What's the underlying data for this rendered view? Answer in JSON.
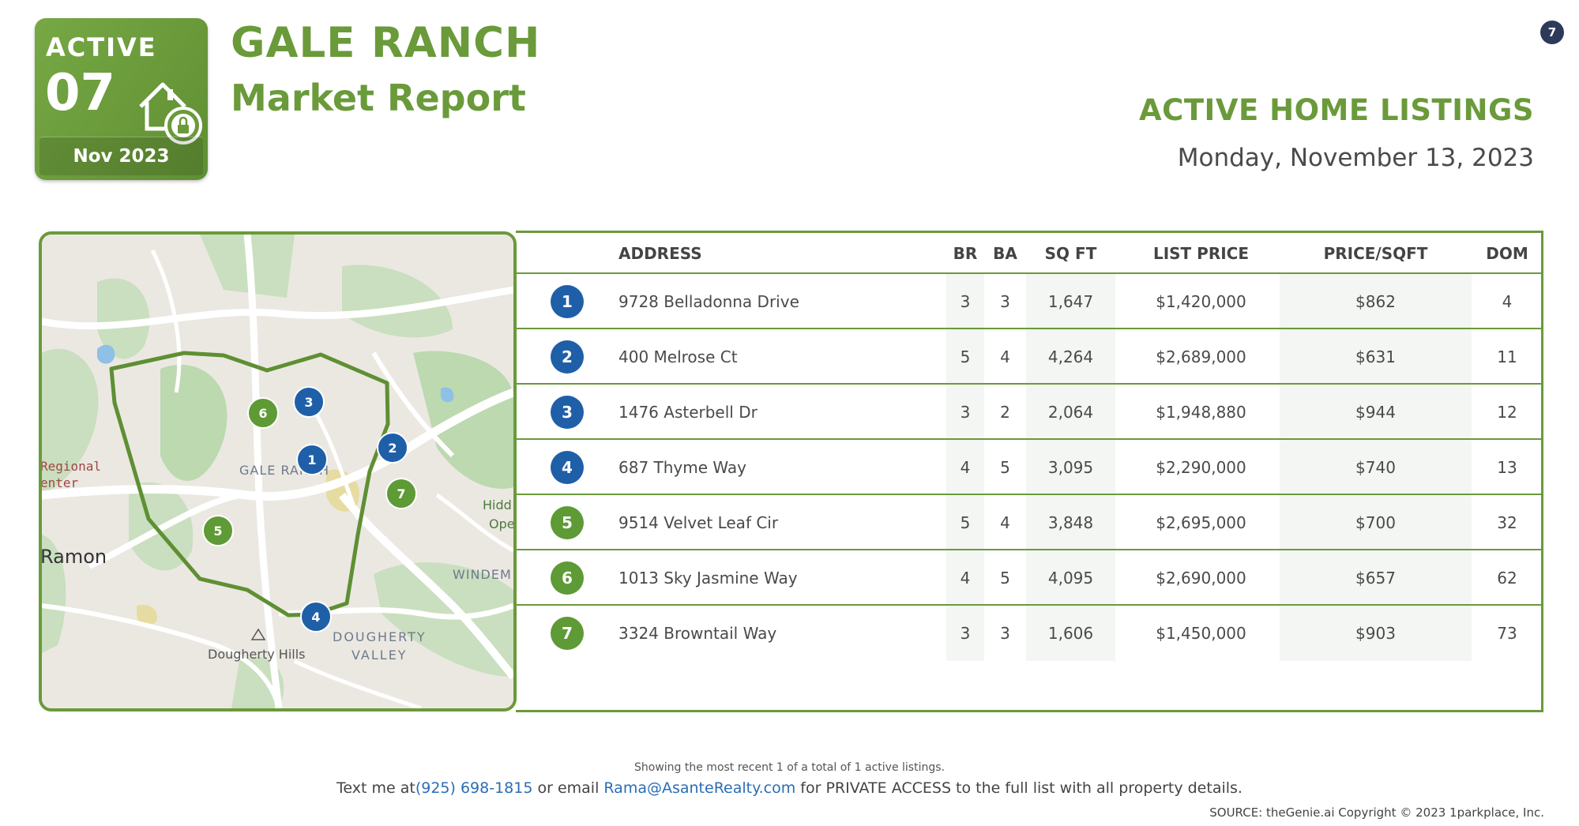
{
  "badge": {
    "status": "ACTIVE",
    "count": "07",
    "month": "Nov 2023",
    "icon": "house-lock-icon"
  },
  "header": {
    "title": "GALE RANCH",
    "subtitle": "Market Report",
    "page_number": "7"
  },
  "section": {
    "title": "ACTIVE HOME LISTINGS",
    "date": "Monday, November 13, 2023"
  },
  "map": {
    "labels": {
      "gale_ranch": "GALE RANCH",
      "regional": "Regional",
      "center": "enter",
      "ramon": "Ramon",
      "hidden": "Hidd",
      "open": "Ope",
      "windem": "WINDEM",
      "dougherty_hills": "Dougherty Hills",
      "dougherty": "DOUGHERTY",
      "valley": "VALLEY"
    },
    "markers": [
      "1",
      "2",
      "3",
      "4",
      "5",
      "6",
      "7"
    ]
  },
  "table": {
    "headers": {
      "address": "ADDRESS",
      "br": "BR",
      "ba": "BA",
      "sqft": "SQ FT",
      "list_price": "LIST PRICE",
      "price_sqft": "PRICE/SQFT",
      "dom": "DOM"
    },
    "rows": [
      {
        "num": "1",
        "address": "9728 Belladonna Drive",
        "br": "3",
        "ba": "3",
        "sqft": "1,647",
        "price": "$1,420,000",
        "ppsf": "$862",
        "dom": "4",
        "color": "#1f5fa8"
      },
      {
        "num": "2",
        "address": "400 Melrose Ct",
        "br": "5",
        "ba": "4",
        "sqft": "4,264",
        "price": "$2,689,000",
        "ppsf": "$631",
        "dom": "11",
        "color": "#1f5fa8"
      },
      {
        "num": "3",
        "address": "1476 Asterbell Dr",
        "br": "3",
        "ba": "2",
        "sqft": "2,064",
        "price": "$1,948,880",
        "ppsf": "$944",
        "dom": "12",
        "color": "#1f5fa8"
      },
      {
        "num": "4",
        "address": "687 Thyme Way",
        "br": "4",
        "ba": "5",
        "sqft": "3,095",
        "price": "$2,290,000",
        "ppsf": "$740",
        "dom": "13",
        "color": "#1f5fa8"
      },
      {
        "num": "5",
        "address": "9514 Velvet Leaf Cir",
        "br": "5",
        "ba": "4",
        "sqft": "3,848",
        "price": "$2,695,000",
        "ppsf": "$700",
        "dom": "32",
        "color": "#5e9a35"
      },
      {
        "num": "6",
        "address": "1013 Sky Jasmine Way",
        "br": "4",
        "ba": "5",
        "sqft": "4,095",
        "price": "$2,690,000",
        "ppsf": "$657",
        "dom": "62",
        "color": "#5e9a35"
      },
      {
        "num": "7",
        "address": "3324 Browntail Way",
        "br": "3",
        "ba": "3",
        "sqft": "1,606",
        "price": "$1,450,000",
        "ppsf": "$903",
        "dom": "73",
        "color": "#5e9a35"
      }
    ]
  },
  "footer": {
    "showing": "Showing the most recent 1 of a total of 1 active listings.",
    "text_prefix": "Text me at",
    "phone": "(925) 698-1815",
    "or_email": " or email ",
    "email": "Rama@AsanteRealty.com",
    "suffix": " for PRIVATE ACCESS to the full list with all property details.",
    "source": "SOURCE: theGenie.ai Copyright © 2023 1parkplace, Inc."
  },
  "colors": {
    "brand_green": "#6a9a3a",
    "marker_blue": "#1f5fa8",
    "marker_green": "#5e9a35",
    "link_blue": "#2a6db5"
  }
}
